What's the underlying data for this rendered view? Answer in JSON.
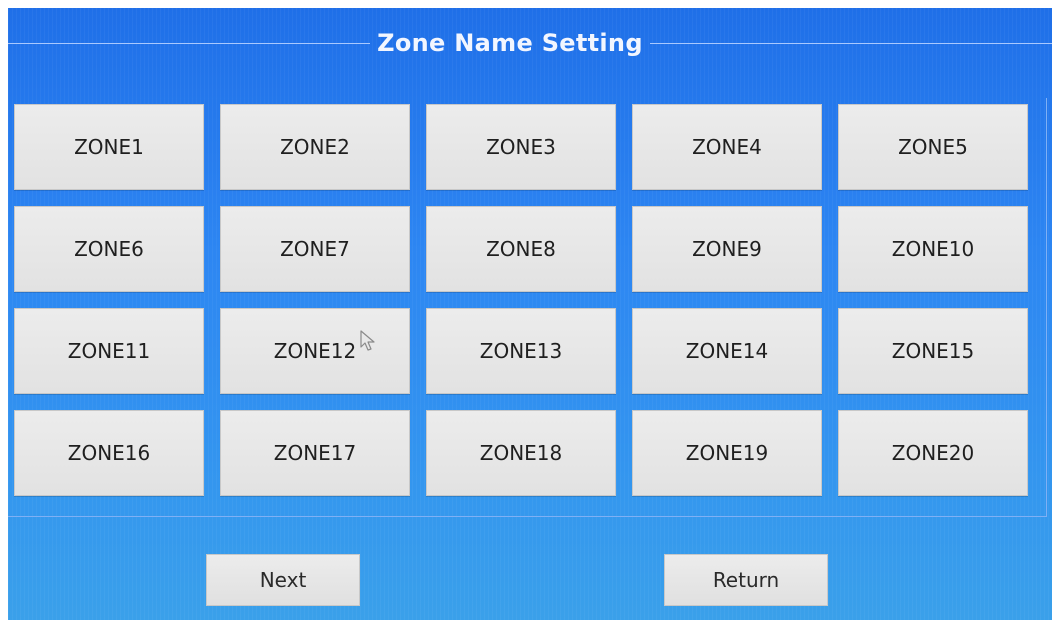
{
  "screen": {
    "title": "Zone Name Setting",
    "background_color": "#2d86f2"
  },
  "zones": [
    {
      "label": "ZONE1"
    },
    {
      "label": "ZONE2"
    },
    {
      "label": "ZONE3"
    },
    {
      "label": "ZONE4"
    },
    {
      "label": "ZONE5"
    },
    {
      "label": "ZONE6"
    },
    {
      "label": "ZONE7"
    },
    {
      "label": "ZONE8"
    },
    {
      "label": "ZONE9"
    },
    {
      "label": "ZONE10"
    },
    {
      "label": "ZONE11"
    },
    {
      "label": "ZONE12"
    },
    {
      "label": "ZONE13"
    },
    {
      "label": "ZONE14"
    },
    {
      "label": "ZONE15"
    },
    {
      "label": "ZONE16"
    },
    {
      "label": "ZONE17"
    },
    {
      "label": "ZONE18"
    },
    {
      "label": "ZONE19"
    },
    {
      "label": "ZONE20"
    }
  ],
  "footer": {
    "next_label": "Next",
    "return_label": "Return"
  },
  "cursor": {
    "icon": "mouse-pointer-icon"
  }
}
